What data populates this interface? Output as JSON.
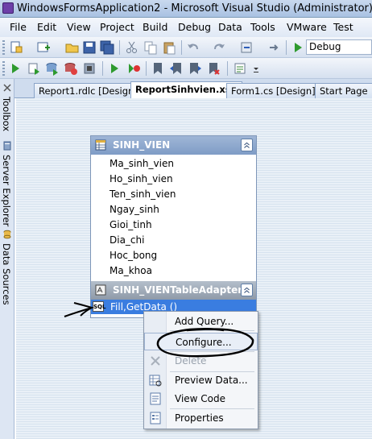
{
  "window": {
    "title": "WindowsFormsApplication2 - Microsoft Visual Studio (Administrator)"
  },
  "menu": [
    "File",
    "Edit",
    "View",
    "Project",
    "Build",
    "Debug",
    "Data",
    "Tools",
    "VMware",
    "Test"
  ],
  "toolbar": {
    "config_value": "Debug"
  },
  "side_tabs": [
    "Toolbox",
    "Server Explorer",
    "Data Sources"
  ],
  "doc_tabs": [
    {
      "label": "Report1.rdlc [Design]",
      "active": false
    },
    {
      "label": "ReportSinhvien.xsd",
      "active": true
    },
    {
      "label": "Form1.cs [Design]",
      "active": false
    },
    {
      "label": "Start Page",
      "active": false
    }
  ],
  "datatable": {
    "name": "SINH_VIEN",
    "columns": [
      "Ma_sinh_vien",
      "Ho_sinh_vien",
      "Ten_sinh_vien",
      "Ngay_sinh",
      "Gioi_tinh",
      "Dia_chi",
      "Hoc_bong",
      "Ma_khoa"
    ],
    "adapter_name": "SINH_VIENTableAdapter",
    "query": "Fill,GetData ()"
  },
  "context_menu": [
    {
      "label": "Add Query...",
      "icon": "none",
      "enabled": true
    },
    {
      "label": "Configure...",
      "icon": "none",
      "enabled": true
    },
    {
      "label": "Delete",
      "icon": "delete-x-icon",
      "enabled": false
    },
    {
      "label": "Preview Data...",
      "icon": "preview-data-icon",
      "enabled": true
    },
    {
      "label": "View Code",
      "icon": "view-code-icon",
      "enabled": true
    },
    {
      "label": "Properties",
      "icon": "properties-icon",
      "enabled": true
    }
  ],
  "colors": {
    "selection": "#3a7de0",
    "header": "#8aa4cc",
    "annotation": "#000000"
  }
}
